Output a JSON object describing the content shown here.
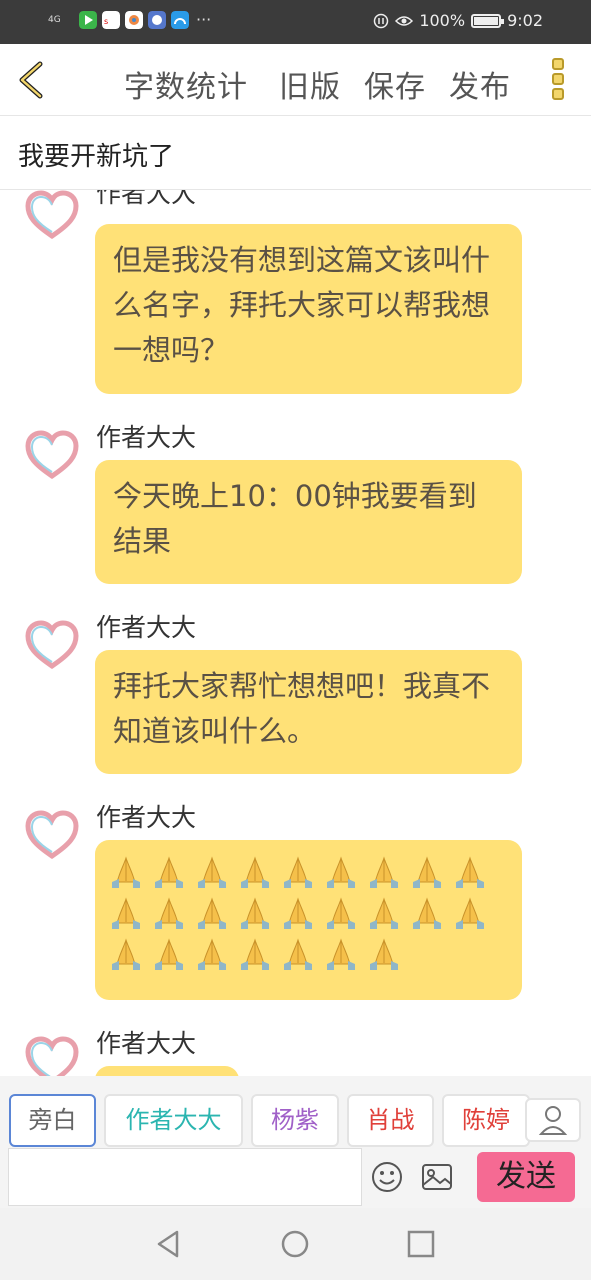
{
  "status_bar": {
    "signal": "4G",
    "apps": [
      "video-app-icon",
      "sohu-app-icon",
      "camera-app-icon",
      "media-app-icon",
      "browser-app-icon"
    ],
    "more": "···",
    "battery": "100%",
    "time": "9:02"
  },
  "toolbar": {
    "word_count": "字数统计",
    "old_version": "旧版",
    "save": "保存",
    "publish": "发布"
  },
  "story": {
    "title": "我要开新坑了"
  },
  "messages": [
    {
      "name": "作者大大",
      "text": "但是我没有想到这篇文该叫什么名字，拜托大家可以帮我想一想吗？"
    },
    {
      "name": "作者大大",
      "text": "今天晚上10：00钟我要看到结果"
    },
    {
      "name": "作者大大",
      "text": "拜托大家帮忙想想吧！我真不知道该叫什么。"
    },
    {
      "name": "作者大大",
      "emoji": "🙏",
      "emoji_count": 25
    },
    {
      "name": "作者大大"
    }
  ],
  "characters": [
    {
      "label": "旁白",
      "color": "#666666",
      "selected": true
    },
    {
      "label": "作者大大",
      "color": "#2bb5b0"
    },
    {
      "label": "杨紫",
      "color": "#a060c8"
    },
    {
      "label": "肖战",
      "color": "#e0403a"
    },
    {
      "label": "陈婷",
      "color": "#e0403a"
    }
  ],
  "composer": {
    "placeholder": "",
    "send_label": "发送"
  },
  "colors": {
    "bubble": "#ffe177",
    "send": "#f56a93",
    "accent": "#f3d66b"
  }
}
